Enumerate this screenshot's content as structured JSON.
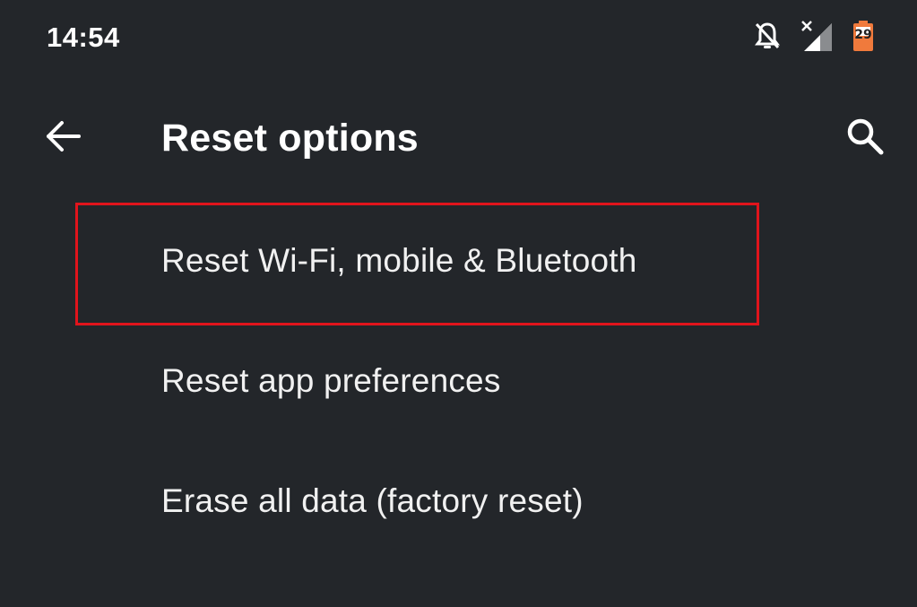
{
  "status_bar": {
    "time": "14:54",
    "icons": [
      "notifications-off-icon",
      "signal-no-service-icon",
      "battery-icon"
    ],
    "battery_level": "29",
    "battery_color": "#f07a3c"
  },
  "app_bar": {
    "back_icon": "arrow-back-icon",
    "title": "Reset options",
    "search_icon": "search-icon"
  },
  "options": [
    {
      "label": "Reset Wi-Fi, mobile & Bluetooth",
      "highlighted": true
    },
    {
      "label": "Reset app preferences",
      "highlighted": false
    },
    {
      "label": "Erase all data (factory reset)",
      "highlighted": false
    }
  ],
  "colors": {
    "background": "#23262a",
    "text": "#f1f1f1",
    "highlight_border": "#e0141c"
  }
}
